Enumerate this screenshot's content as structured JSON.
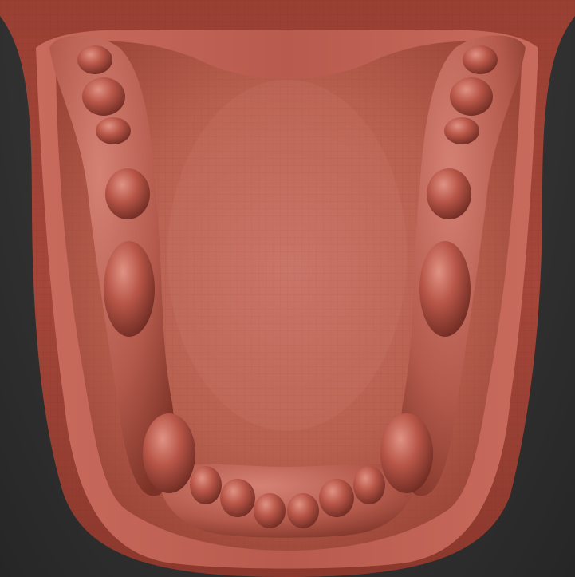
{
  "scene": {
    "subject_icon": "sculpted-jaw-model",
    "colors": {
      "background": "#2e2e2e",
      "clay_base": "#b25548",
      "clay_light": "#cf7d70",
      "clay_dark": "#6e2a22",
      "wire": "#a04a3e"
    }
  }
}
